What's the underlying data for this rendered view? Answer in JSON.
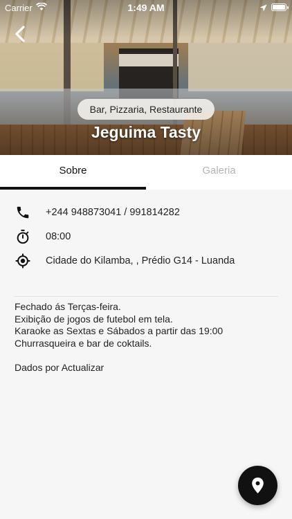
{
  "status_bar": {
    "carrier": "Carrier",
    "time": "1:49 AM"
  },
  "header": {
    "category": "Bar, Pizzaria, Restaurante",
    "title": "Jeguima Tasty"
  },
  "tabs": [
    {
      "label": "Sobre",
      "active": true
    },
    {
      "label": "Galeria",
      "active": false
    }
  ],
  "details": {
    "phone": "+244 948873041 / 991814282",
    "hours": "08:00",
    "address": "Cidade do Kilamba, , Prédio G14 - Luanda"
  },
  "description": [
    "Fechado ás Terças-feira.",
    "Exibição de jogos de futebol em tela.",
    "Karaoke as Sextas e Sábados a partir das 19:00",
    "Churrasqueira e bar de coktails.",
    "",
    "Dados por Actualizar"
  ],
  "icons": {
    "back": "chevron-left-icon",
    "phone": "phone-icon",
    "hours": "stopwatch-icon",
    "address": "location-target-icon",
    "map": "map-pin-icon"
  },
  "colors": {
    "accent": "#111111",
    "inactive_tab": "#b4b4b4",
    "background": "#f6f6f6"
  }
}
